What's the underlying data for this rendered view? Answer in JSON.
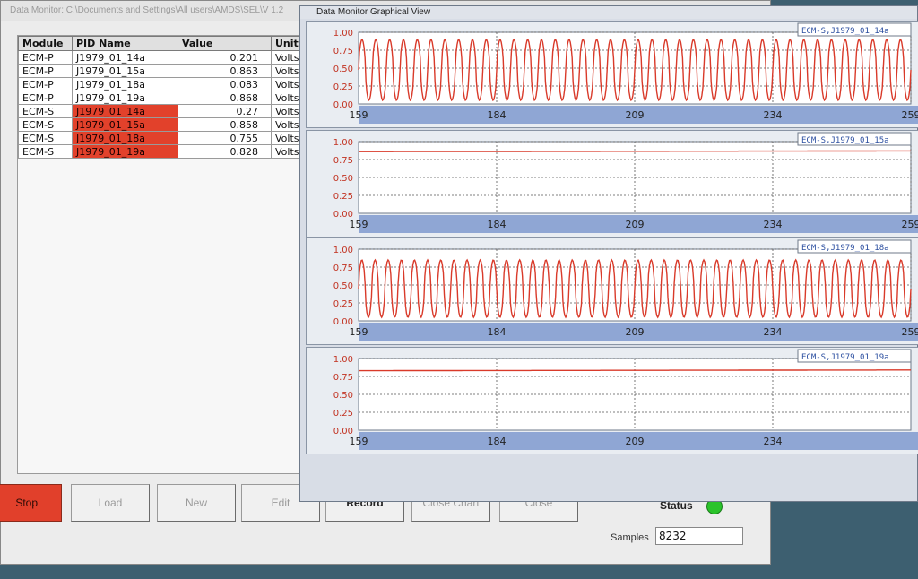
{
  "main_window": {
    "title": "Data Monitor: C:\\Documents and Settings\\All users\\AMDS\\SEL\\V 1.2"
  },
  "table": {
    "headers": [
      "Module",
      "PID Name",
      "Value",
      "Units"
    ],
    "rows": [
      {
        "module": "ECM-P",
        "pid": "J1979_01_14a",
        "value": "0.201",
        "units": "Volts"
      },
      {
        "module": "ECM-P",
        "pid": "J1979_01_15a",
        "value": "0.863",
        "units": "Volts"
      },
      {
        "module": "ECM-P",
        "pid": "J1979_01_18a",
        "value": "0.083",
        "units": "Volts"
      },
      {
        "module": "ECM-P",
        "pid": "J1979_01_19a",
        "value": "0.868",
        "units": "Volts"
      },
      {
        "module": "ECM-S",
        "pid": "J1979_01_14a",
        "value": "0.27",
        "units": "Volts"
      },
      {
        "module": "ECM-S",
        "pid": "J1979_01_15a",
        "value": "0.858",
        "units": "Volts"
      },
      {
        "module": "ECM-S",
        "pid": "J1979_01_18a",
        "value": "0.755",
        "units": "Volts"
      },
      {
        "module": "ECM-S",
        "pid": "J1979_01_19a",
        "value": "0.828",
        "units": "Volts"
      }
    ],
    "highlight_color": "#e2412b"
  },
  "buttons": {
    "stop": "Stop",
    "load": "Load",
    "new": "New",
    "edit": "Edit",
    "record": "Record",
    "close_chart": "Close Chart",
    "close": "Close"
  },
  "status": {
    "label": "Status",
    "led_color": "#2bc32b",
    "samples_label": "Samples",
    "samples_value": "8232"
  },
  "graph_window": {
    "title": "Data Monitor Graphical View"
  },
  "chart_data": [
    {
      "type": "line",
      "series_label": "ECM-S,J1979_01_14a",
      "x_ticks": [
        159,
        184,
        209,
        234,
        259
      ],
      "y_ticks": [
        "0.00",
        "0.25",
        "0.50",
        "0.75",
        "1.00"
      ],
      "xlim": [
        159,
        259
      ],
      "ylim": [
        0,
        1
      ],
      "pattern": "oscillating",
      "low": 0.05,
      "high": 0.9,
      "cycles": 40,
      "line_color": "#d93a2a"
    },
    {
      "type": "line",
      "series_label": "ECM-S,J1979_01_15a",
      "x_ticks": [
        159,
        184,
        209,
        234,
        259
      ],
      "y_ticks": [
        "0.00",
        "0.25",
        "0.50",
        "0.75",
        "1.00"
      ],
      "xlim": [
        159,
        259
      ],
      "ylim": [
        0,
        1
      ],
      "pattern": "flat",
      "low": 0.86,
      "high": 0.87,
      "cycles": 0,
      "line_color": "#d93a2a"
    },
    {
      "type": "line",
      "series_label": "ECM-S,J1979_01_18a",
      "x_ticks": [
        159,
        184,
        209,
        234,
        259
      ],
      "y_ticks": [
        "0.00",
        "0.25",
        "0.50",
        "0.75",
        "1.00"
      ],
      "xlim": [
        159,
        259
      ],
      "ylim": [
        0,
        1
      ],
      "pattern": "oscillating",
      "low": 0.05,
      "high": 0.85,
      "cycles": 42,
      "line_color": "#d93a2a"
    },
    {
      "type": "line",
      "series_label": "ECM-S,J1979_01_19a",
      "x_ticks": [
        159,
        184,
        209,
        234
      ],
      "y_ticks": [
        "0.00",
        "0.25",
        "0.50",
        "0.75",
        "1.00"
      ],
      "xlim": [
        159,
        259
      ],
      "ylim": [
        0,
        1
      ],
      "pattern": "flat",
      "low": 0.83,
      "high": 0.84,
      "cycles": 0,
      "line_color": "#d93a2a"
    }
  ]
}
